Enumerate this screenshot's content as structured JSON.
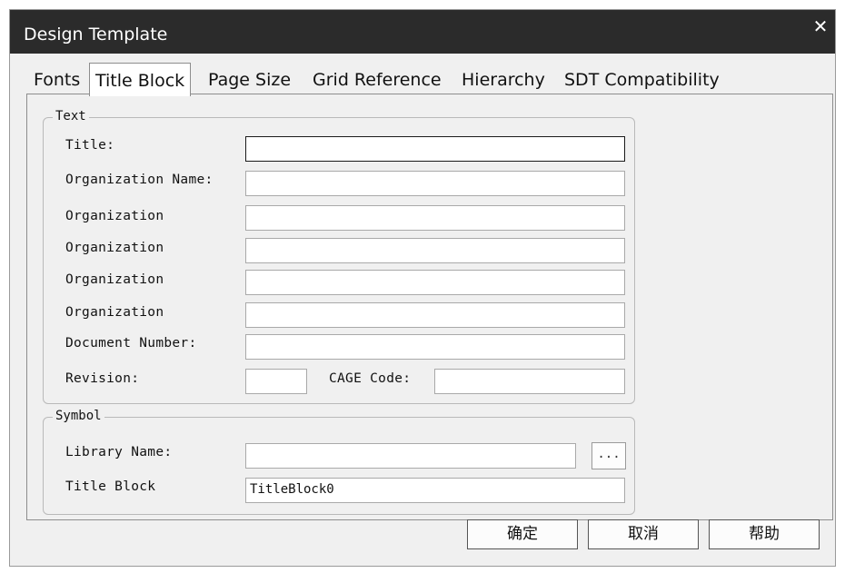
{
  "window": {
    "title": "Design Template",
    "close_glyph": "✕"
  },
  "tabs": [
    "Fonts",
    "Title Block",
    "Page Size",
    "Grid Reference",
    "Hierarchy",
    "SDT Compatibility"
  ],
  "active_tab": "Title Block",
  "text_group": {
    "label": "Text",
    "fields": {
      "title": {
        "label": "Title:",
        "value": ""
      },
      "organization_name": {
        "label": "Organization Name:",
        "value": ""
      },
      "organization_address_1": {
        "label": "Organization",
        "value": ""
      },
      "organization_address_2": {
        "label": "Organization",
        "value": ""
      },
      "organization_address_3": {
        "label": "Organization",
        "value": ""
      },
      "organization_address_4": {
        "label": "Organization",
        "value": ""
      },
      "document_number": {
        "label": "Document Number:",
        "value": ""
      },
      "revision": {
        "label": "Revision:",
        "value": ""
      },
      "cage_code": {
        "label": "CAGE Code:",
        "value": ""
      }
    }
  },
  "symbol_group": {
    "label": "Symbol",
    "library_name": {
      "label": "Library Name:",
      "value": "",
      "browse_label": "..."
    },
    "title_block_name": {
      "label": "Title Block",
      "value": "TitleBlock0"
    }
  },
  "buttons": {
    "ok": "确定",
    "cancel": "取消",
    "help": "帮助"
  },
  "colors": {
    "titlebar": "#2b2b2b",
    "dialog_bg": "#f0f0f0"
  },
  "icons": {
    "close": "close-icon"
  }
}
